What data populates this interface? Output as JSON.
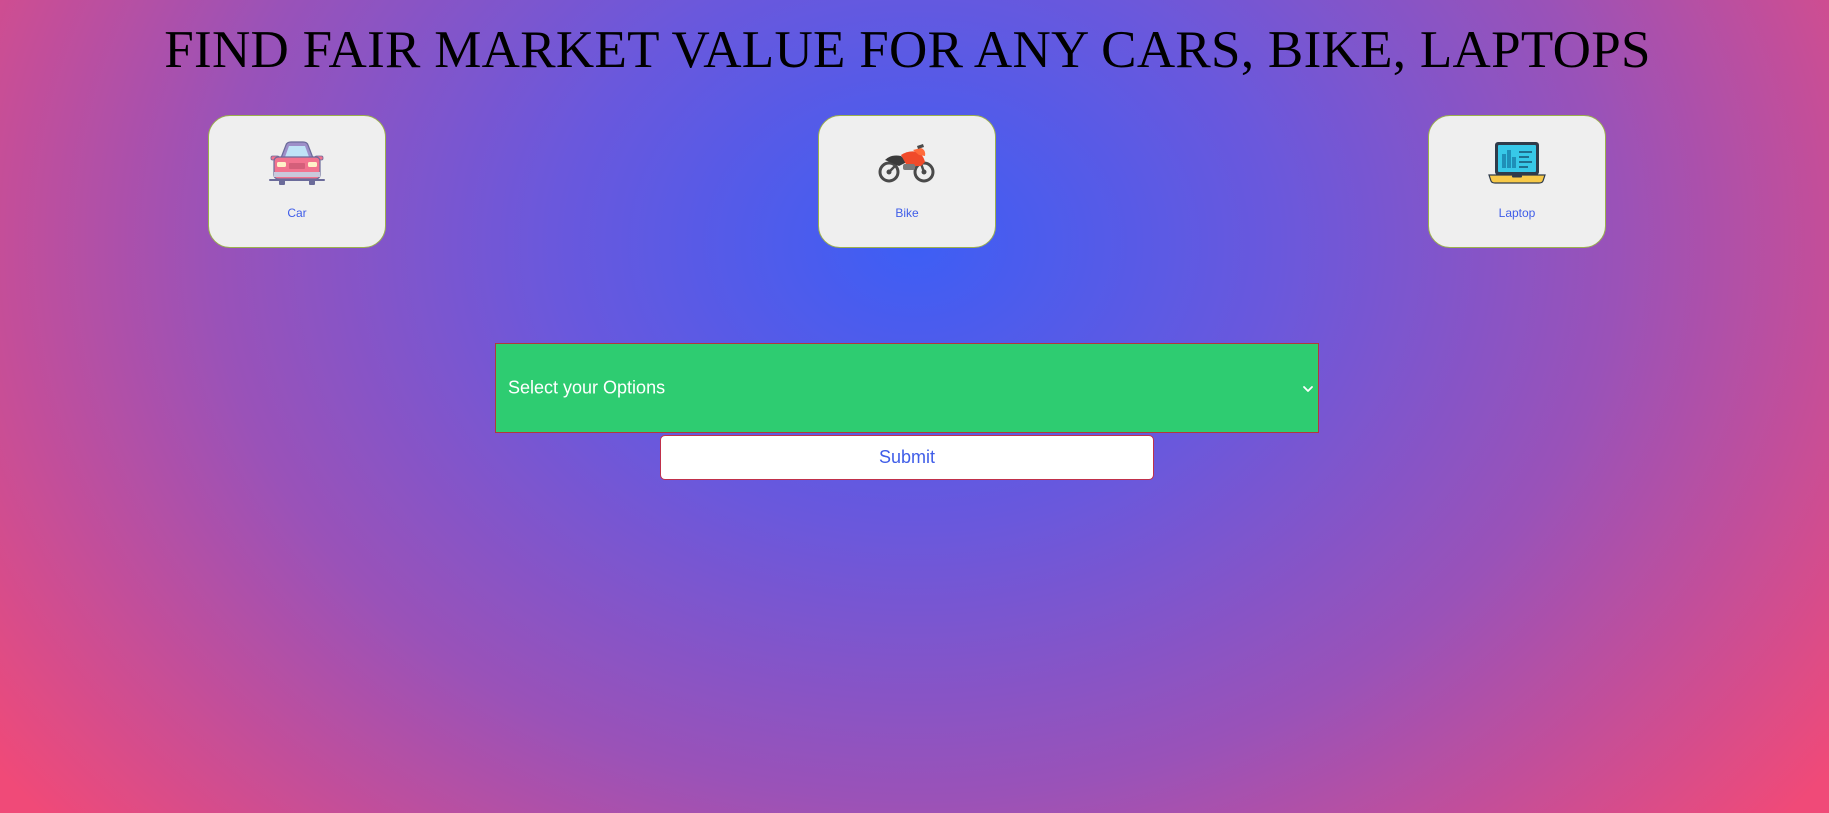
{
  "header": {
    "title": "FIND FAIR MARKET VALUE FOR ANY CARS, BIKE, LAPTOPS"
  },
  "categories": [
    {
      "label": "Car",
      "icon": "car-icon"
    },
    {
      "label": "Bike",
      "icon": "motorbike-icon"
    },
    {
      "label": "Laptop",
      "icon": "laptop-icon"
    }
  ],
  "form": {
    "select_value": "Select your Options",
    "submit_label": "Submit"
  },
  "colors": {
    "select_background": "#2ecc71",
    "card_background": "#efefef",
    "accent_text": "#3f5de8",
    "gradient_center": "#3d5ef5",
    "gradient_edge": "#f04a78"
  }
}
